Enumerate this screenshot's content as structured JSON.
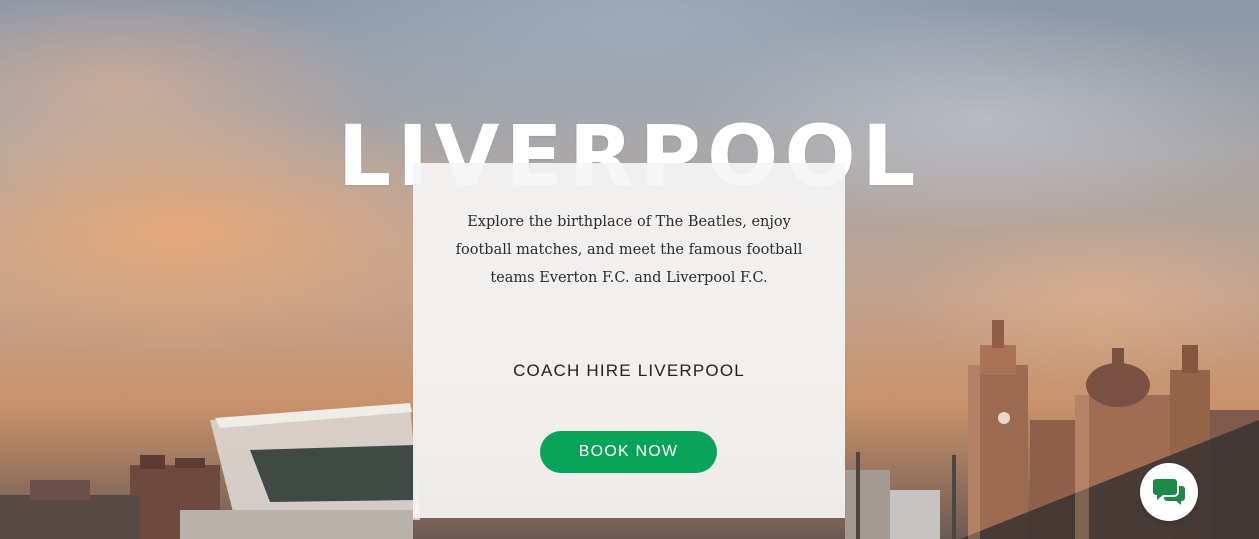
{
  "hero": {
    "title": "LIVERPOOL",
    "background": "Liverpool waterfront skyline at sunset"
  },
  "card": {
    "description": "Explore the birthplace of The Beatles, enjoy football matches, and meet the famous football teams Everton F.C. and Liverpool F.C.",
    "subtitle": "COACH HIRE LIVERPOOL",
    "button_label": "BOOK NOW"
  },
  "chat_widget": {
    "icon": "chat-bubbles-icon"
  },
  "colors": {
    "accent": "#0aa35a",
    "card_bg": "#f5f5f5",
    "title": "#ffffff"
  }
}
